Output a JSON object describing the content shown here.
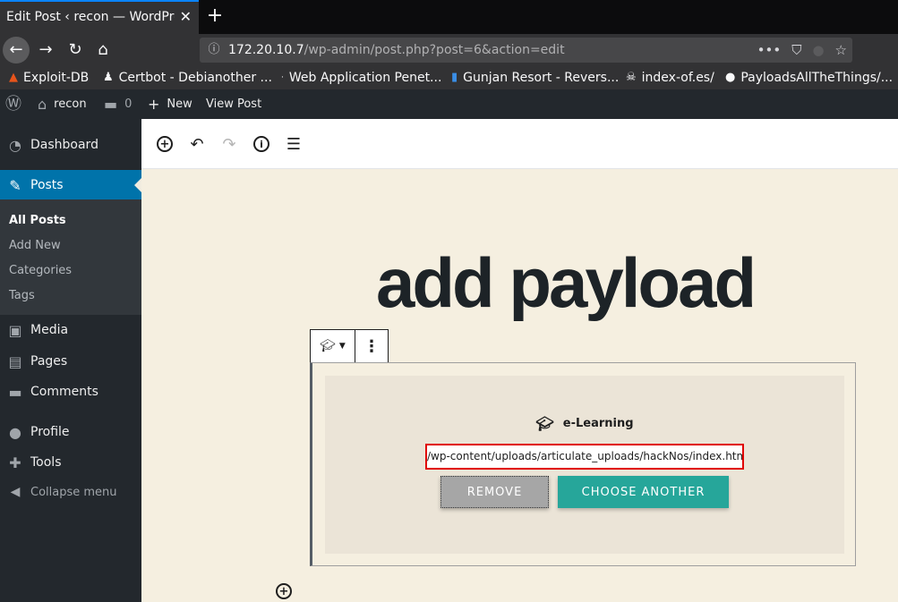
{
  "browser": {
    "tab_title": "Edit Post ‹ recon — WordPress",
    "new_tab": "+",
    "url_host": "172.20.10.7",
    "url_path": "/wp-admin/post.php?post=6&action=edit",
    "bookmarks": [
      "Exploit-DB",
      "Certbot - Debianother ...",
      "Web Application Penet...",
      "Gunjan Resort - Revers...",
      "index-of.es/",
      "PayloadsAllTheThings/..."
    ]
  },
  "adminbar": {
    "site_name": "recon",
    "comments_count": "0",
    "new_label": "New",
    "view_post": "View Post"
  },
  "sidebar": {
    "dashboard": "Dashboard",
    "posts": "Posts",
    "submenu": [
      "All Posts",
      "Add New",
      "Categories",
      "Tags"
    ],
    "media": "Media",
    "pages": "Pages",
    "comments": "Comments",
    "profile": "Profile",
    "tools": "Tools",
    "collapse": "Collapse menu"
  },
  "editor": {
    "post_title": "add payload",
    "block": {
      "name": "e-Learning",
      "file_path": "/wp-content/uploads/articulate_uploads/hackNos/index.html",
      "remove_label": "REMOVE",
      "choose_label": "CHOOSE ANOTHER"
    }
  },
  "colors": {
    "accent": "#0073aa",
    "teal_button": "#26a69a",
    "highlight_border": "#e00000"
  }
}
